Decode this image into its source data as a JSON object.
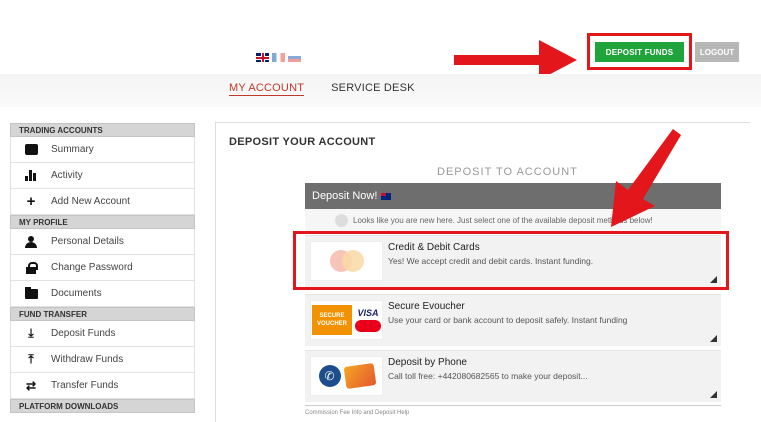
{
  "header": {
    "languages": [
      "en",
      "fr",
      "ru"
    ],
    "deposit_button": "DEPOSIT FUNDS",
    "logout_button": "LOGOUT",
    "nav": [
      {
        "label": "MY ACCOUNT",
        "active": true
      },
      {
        "label": "SERVICE DESK",
        "active": false
      }
    ]
  },
  "sidebar": {
    "sections": [
      {
        "title": "TRADING ACCOUNTS",
        "items": [
          {
            "label": "Summary",
            "icon": "briefcase-icon"
          },
          {
            "label": "Activity",
            "icon": "bar-chart-icon"
          },
          {
            "label": "Add New Account",
            "icon": "plus-icon"
          }
        ]
      },
      {
        "title": "MY PROFILE",
        "items": [
          {
            "label": "Personal Details",
            "icon": "user-icon"
          },
          {
            "label": "Change Password",
            "icon": "lock-icon"
          },
          {
            "label": "Documents",
            "icon": "folder-icon"
          }
        ]
      },
      {
        "title": "FUND TRANSFER",
        "items": [
          {
            "label": "Deposit Funds",
            "icon": "download-icon"
          },
          {
            "label": "Withdraw Funds",
            "icon": "upload-icon"
          },
          {
            "label": "Transfer Funds",
            "icon": "transfer-icon"
          }
        ]
      },
      {
        "title": "PLATFORM DOWNLOADS",
        "items": []
      }
    ]
  },
  "main": {
    "title": "DEPOSIT YOUR ACCOUNT",
    "subtitle": "DEPOSIT TO ACCOUNT",
    "deposit_now": "Deposit Now!",
    "hint": "Looks like you are new here. Just select one of the available deposit methods below!",
    "methods": [
      {
        "title": "Credit & Debit Cards",
        "desc": "Yes! We accept credit and debit cards. Instant funding."
      },
      {
        "title": "Secure Evoucher",
        "desc": "Use your card or bank account to deposit safely. Instant funding"
      },
      {
        "title": "Deposit by Phone",
        "desc": "Call toll free: +442080682565 to make your deposit..."
      }
    ],
    "footnote": "Commission Fee Info and Deposit Help"
  },
  "colors": {
    "accent_green": "#21a33b",
    "highlight_red": "#e3161b"
  }
}
